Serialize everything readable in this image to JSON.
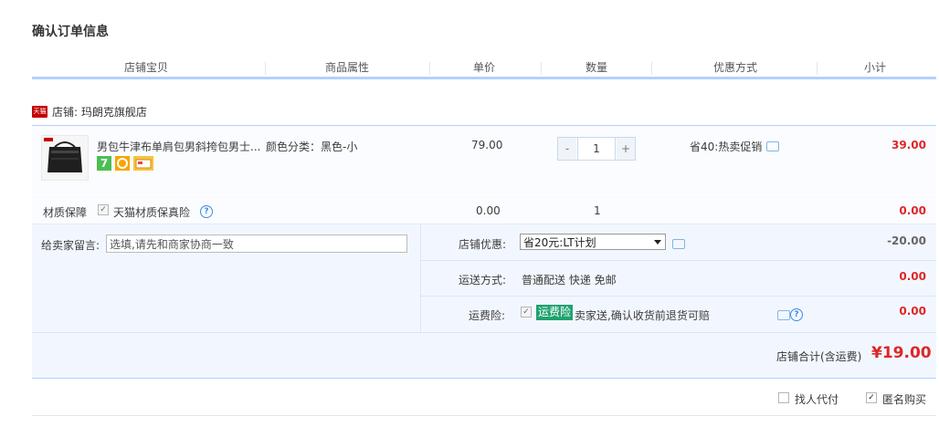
{
  "page": {
    "title": "确认订单信息"
  },
  "header": {
    "columns": [
      "店铺宝贝",
      "商品属性",
      "单价",
      "数量",
      "优惠方式",
      "小计"
    ]
  },
  "store": {
    "badge": "天猫",
    "label": "店铺: 玛朗克旗舰店"
  },
  "item": {
    "title": "男包牛津布单肩包男斜挎包男士...",
    "attribute": "颜色分类：黑色-小",
    "price": "79.00",
    "quantity": "1",
    "minus": "-",
    "plus": "+",
    "discount": "省40:热卖促销",
    "subtotal": "39.00",
    "icons": [
      "seven-day-return-icon",
      "tmall-guarantee-icon",
      "credit-card-icon"
    ]
  },
  "guarantee": {
    "label": "材质保障",
    "option": "天猫材质保真险",
    "price": "0.00",
    "quantity": "1",
    "subtotal": "0.00"
  },
  "memo": {
    "label": "给卖家留言:",
    "value": "选填,请先和商家协商一致"
  },
  "shop_discount": {
    "label": "店铺优惠:",
    "selected": "省20元:LT计划",
    "amount": "-20.00"
  },
  "shipping": {
    "label": "运送方式:",
    "value": "普通配送 快递 免邮",
    "amount": "0.00"
  },
  "insurance": {
    "label": "运费险:",
    "badge": "运费险",
    "text": "卖家送,确认收货前退货可赔",
    "amount": "0.00"
  },
  "total": {
    "label": "店铺合计(含运费)",
    "value": "¥19.00"
  },
  "footer": {
    "proxy_pay": "找人代付",
    "anonymous": "匿名购买"
  },
  "colors": {
    "accent_red": "#dd2727",
    "border_blue": "#b2d1ff",
    "panel_bg": "#f2f7ff",
    "insurance_green": "#1fa26e"
  }
}
